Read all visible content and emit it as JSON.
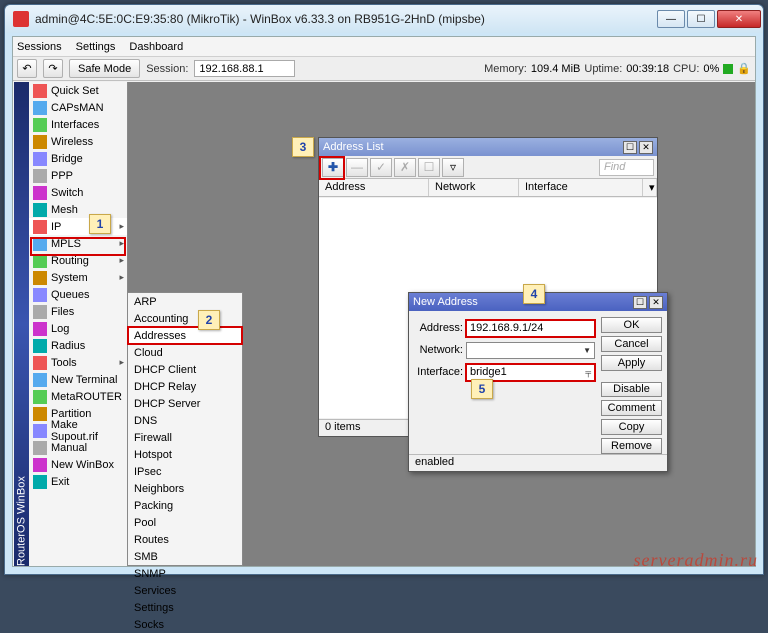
{
  "window": {
    "title": "admin@4C:5E:0C:E9:35:80 (MikroTik) - WinBox v6.33.3 on RB951G-2HnD (mipsbe)"
  },
  "menubar": {
    "items": [
      "Sessions",
      "Settings",
      "Dashboard"
    ]
  },
  "toolbar": {
    "undo_glyph": "↶",
    "redo_glyph": "↷",
    "safe_mode": "Safe Mode",
    "session_label": "Session:",
    "session_value": "192.168.88.1",
    "memory_label": "Memory:",
    "memory_value": "109.4 MiB",
    "uptime_label": "Uptime:",
    "uptime_value": "00:39:18",
    "cpu_label": "CPU:",
    "cpu_value": "0%"
  },
  "vstrip": "RouterOS WinBox",
  "sidebar": {
    "items": [
      {
        "label": "Quick Set",
        "icon": "ic-a"
      },
      {
        "label": "CAPsMAN",
        "icon": "ic-b"
      },
      {
        "label": "Interfaces",
        "icon": "ic-c"
      },
      {
        "label": "Wireless",
        "icon": "ic-d"
      },
      {
        "label": "Bridge",
        "icon": "ic-e"
      },
      {
        "label": "PPP",
        "icon": "ic-f"
      },
      {
        "label": "Switch",
        "icon": "ic-g"
      },
      {
        "label": "Mesh",
        "icon": "ic-h"
      },
      {
        "label": "IP",
        "icon": "ic-a",
        "arrow": true,
        "hl": true
      },
      {
        "label": "MPLS",
        "icon": "ic-b",
        "arrow": true
      },
      {
        "label": "Routing",
        "icon": "ic-c",
        "arrow": true
      },
      {
        "label": "System",
        "icon": "ic-d",
        "arrow": true
      },
      {
        "label": "Queues",
        "icon": "ic-e"
      },
      {
        "label": "Files",
        "icon": "ic-f"
      },
      {
        "label": "Log",
        "icon": "ic-g"
      },
      {
        "label": "Radius",
        "icon": "ic-h"
      },
      {
        "label": "Tools",
        "icon": "ic-a",
        "arrow": true
      },
      {
        "label": "New Terminal",
        "icon": "ic-b"
      },
      {
        "label": "MetaROUTER",
        "icon": "ic-c"
      },
      {
        "label": "Partition",
        "icon": "ic-d"
      },
      {
        "label": "Make Supout.rif",
        "icon": "ic-e"
      },
      {
        "label": "Manual",
        "icon": "ic-f"
      },
      {
        "label": "New WinBox",
        "icon": "ic-g"
      },
      {
        "label": "Exit",
        "icon": "ic-h"
      }
    ]
  },
  "submenu": {
    "items": [
      "ARP",
      "Accounting",
      "Addresses",
      "Cloud",
      "DHCP Client",
      "DHCP Relay",
      "DHCP Server",
      "DNS",
      "Firewall",
      "Hotspot",
      "IPsec",
      "Neighbors",
      "Packing",
      "Pool",
      "Routes",
      "SMB",
      "SNMP",
      "Services",
      "Settings",
      "Socks"
    ],
    "selected_index": 2
  },
  "address_list": {
    "title": "Address List",
    "toolbar": {
      "add": "✚",
      "remove": "—",
      "enable": "✓",
      "disable": "✗",
      "comment": "☐",
      "filter": "▿"
    },
    "find_placeholder": "Find",
    "columns": [
      "Address",
      "Network",
      "Interface"
    ],
    "status": "0 items"
  },
  "new_address": {
    "title": "New Address",
    "labels": {
      "address": "Address:",
      "network": "Network:",
      "interface": "Interface:"
    },
    "values": {
      "address": "192.168.9.1/24",
      "network": "",
      "interface": "bridge1"
    },
    "buttons": [
      "OK",
      "Cancel",
      "Apply",
      "Disable",
      "Comment",
      "Copy",
      "Remove"
    ],
    "status": "enabled"
  },
  "callouts": {
    "1": "1",
    "2": "2",
    "3": "3",
    "4": "4",
    "5": "5"
  },
  "watermark": "serveradmin.ru"
}
